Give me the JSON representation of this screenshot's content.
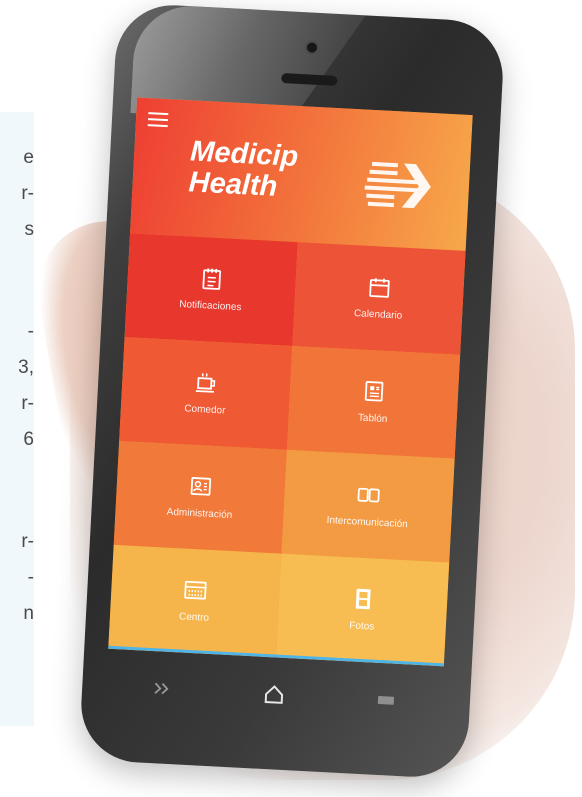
{
  "side_text": {
    "fragments": [
      "e",
      "r-",
      "s",
      "-",
      "3,",
      "r-",
      "6",
      "r-",
      "-",
      "n"
    ]
  },
  "app": {
    "brand_line1": "Medicip",
    "brand_line2": "Health"
  },
  "tiles": [
    {
      "label": "Notificaciones",
      "icon": "notebook-icon",
      "color": "#e8382e"
    },
    {
      "label": "Calendario",
      "icon": "calendar-icon",
      "color": "#ec5337"
    },
    {
      "label": "Comedor",
      "icon": "coffee-icon",
      "color": "#ef5a34"
    },
    {
      "label": "Tablón",
      "icon": "board-icon",
      "color": "#f17538"
    },
    {
      "label": "Administración",
      "icon": "id-card-icon",
      "color": "#f1793a"
    },
    {
      "label": "Intercomunicación",
      "icon": "two-panels-icon",
      "color": "#f39b42"
    },
    {
      "label": "Centro",
      "icon": "keyboard-icon",
      "color": "#f5b54a"
    },
    {
      "label": "Fotos",
      "icon": "film-icon",
      "color": "#f7bd52"
    }
  ],
  "colors": {
    "accent_blue": "#4fb4e6"
  }
}
